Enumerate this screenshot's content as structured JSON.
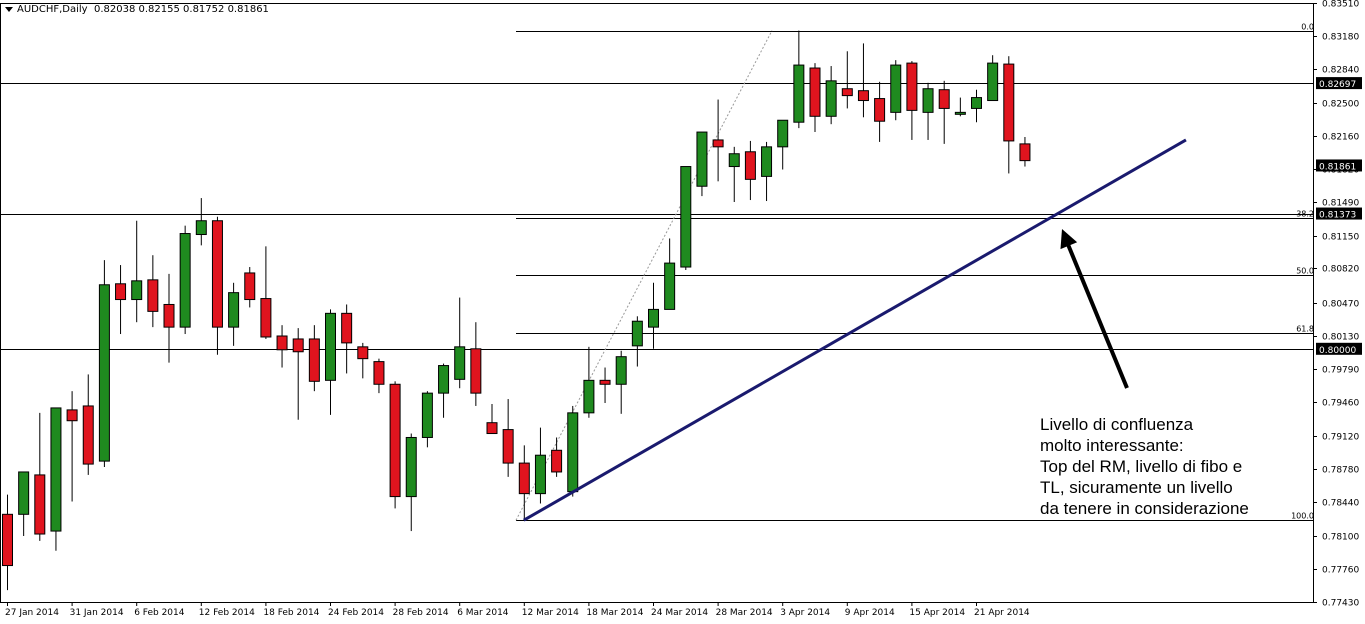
{
  "header": {
    "symbol": "AUDCHF,Daily",
    "ohlc": "0.82038 0.82155 0.81752 0.81861"
  },
  "annotation": {
    "lines": [
      "Livello di confluenza",
      "molto interessante:",
      "Top del RM, livello di fibo e",
      "TL, sicuramente un livello",
      "da tenere in considerazione"
    ]
  },
  "colors": {
    "bull": "#1f8a1f",
    "bear": "#e0141e",
    "trendline": "#1a1a6e",
    "text": "#000000"
  },
  "chart_data": {
    "type": "candlestick",
    "ylim": [
      0.7743,
      0.8351
    ],
    "y_ticks": [
      "0.83510",
      "0.83180",
      "0.82840",
      "0.82500",
      "0.82160",
      "0.81820",
      "0.81490",
      "0.81150",
      "0.80820",
      "0.80470",
      "0.80130",
      "0.79790",
      "0.79460",
      "0.79120",
      "0.78780",
      "0.78440",
      "0.78100",
      "0.77760",
      "0.77430"
    ],
    "x_ticks": [
      "27 Jan 2014",
      "31 Jan 2014",
      "6 Feb 2014",
      "12 Feb 2014",
      "18 Feb 2014",
      "24 Feb 2014",
      "28 Feb 2014",
      "6 Mar 2014",
      "12 Mar 2014",
      "18 Mar 2014",
      "24 Mar 2014",
      "28 Mar 2014",
      "3 Apr 2014",
      "9 Apr 2014",
      "15 Apr 2014",
      "21 Apr 2014"
    ],
    "price_labels": [
      {
        "text": "0.82697",
        "value": 0.82697
      },
      {
        "text": "0.81861",
        "value": 0.81861
      },
      {
        "text": "0.81373",
        "value": 0.81373
      },
      {
        "text": "0.80000",
        "value": 0.8
      }
    ],
    "horizontal_lines": [
      0.82697,
      0.81373,
      0.8
    ],
    "fibonacci": {
      "levels": [
        {
          "label": "0.0",
          "value": 0.8323
        },
        {
          "label": "38.2",
          "value": 0.8133
        },
        {
          "label": "50.0",
          "value": 0.8075
        },
        {
          "label": "61.8",
          "value": 0.8016
        },
        {
          "label": "100.0",
          "value": 0.7826
        }
      ]
    },
    "trendline": {
      "from": {
        "x": 32,
        "y": 0.7826
      },
      "to": {
        "x": 73,
        "y": 0.8212
      }
    },
    "candles": [
      {
        "i": 0,
        "o": 0.7832,
        "h": 0.7852,
        "l": 0.7755,
        "c": 0.778
      },
      {
        "i": 1,
        "o": 0.7832,
        "h": 0.7874,
        "l": 0.781,
        "c": 0.7875
      },
      {
        "i": 2,
        "o": 0.7872,
        "h": 0.7935,
        "l": 0.7805,
        "c": 0.7812
      },
      {
        "i": 3,
        "o": 0.7815,
        "h": 0.794,
        "l": 0.7795,
        "c": 0.794
      },
      {
        "i": 4,
        "o": 0.7938,
        "h": 0.7957,
        "l": 0.7845,
        "c": 0.7927
      },
      {
        "i": 5,
        "o": 0.7942,
        "h": 0.7974,
        "l": 0.7872,
        "c": 0.7883
      },
      {
        "i": 6,
        "o": 0.7886,
        "h": 0.809,
        "l": 0.788,
        "c": 0.8065
      },
      {
        "i": 7,
        "o": 0.8066,
        "h": 0.8085,
        "l": 0.8015,
        "c": 0.805
      },
      {
        "i": 8,
        "o": 0.805,
        "h": 0.813,
        "l": 0.8027,
        "c": 0.8069
      },
      {
        "i": 9,
        "o": 0.807,
        "h": 0.8095,
        "l": 0.8022,
        "c": 0.8038
      },
      {
        "i": 10,
        "o": 0.8045,
        "h": 0.8076,
        "l": 0.7986,
        "c": 0.8022
      },
      {
        "i": 11,
        "o": 0.8022,
        "h": 0.8125,
        "l": 0.8015,
        "c": 0.8117
      },
      {
        "i": 12,
        "o": 0.8116,
        "h": 0.8153,
        "l": 0.8105,
        "c": 0.813
      },
      {
        "i": 13,
        "o": 0.813,
        "h": 0.8134,
        "l": 0.7994,
        "c": 0.8022
      },
      {
        "i": 14,
        "o": 0.8022,
        "h": 0.8067,
        "l": 0.8003,
        "c": 0.8057
      },
      {
        "i": 15,
        "o": 0.8077,
        "h": 0.8083,
        "l": 0.8042,
        "c": 0.805
      },
      {
        "i": 16,
        "o": 0.8051,
        "h": 0.8104,
        "l": 0.801,
        "c": 0.8012
      },
      {
        "i": 17,
        "o": 0.8013,
        "h": 0.8024,
        "l": 0.7981,
        "c": 0.7999
      },
      {
        "i": 18,
        "o": 0.801,
        "h": 0.8021,
        "l": 0.7928,
        "c": 0.7997
      },
      {
        "i": 19,
        "o": 0.801,
        "h": 0.8024,
        "l": 0.7957,
        "c": 0.7967
      },
      {
        "i": 20,
        "o": 0.7968,
        "h": 0.804,
        "l": 0.7933,
        "c": 0.8036
      },
      {
        "i": 21,
        "o": 0.8036,
        "h": 0.8045,
        "l": 0.7975,
        "c": 0.8006
      },
      {
        "i": 22,
        "o": 0.8002,
        "h": 0.8006,
        "l": 0.797,
        "c": 0.799
      },
      {
        "i": 23,
        "o": 0.7987,
        "h": 0.799,
        "l": 0.7955,
        "c": 0.7964
      },
      {
        "i": 24,
        "o": 0.7964,
        "h": 0.7967,
        "l": 0.7838,
        "c": 0.785
      },
      {
        "i": 25,
        "o": 0.785,
        "h": 0.7914,
        "l": 0.7815,
        "c": 0.791
      },
      {
        "i": 26,
        "o": 0.791,
        "h": 0.7957,
        "l": 0.79,
        "c": 0.7955
      },
      {
        "i": 27,
        "o": 0.7955,
        "h": 0.7985,
        "l": 0.793,
        "c": 0.7983
      },
      {
        "i": 28,
        "o": 0.7969,
        "h": 0.8052,
        "l": 0.796,
        "c": 0.8002
      },
      {
        "i": 29,
        "o": 0.8,
        "h": 0.8027,
        "l": 0.7942,
        "c": 0.7955
      },
      {
        "i": 30,
        "o": 0.7925,
        "h": 0.7944,
        "l": 0.7916,
        "c": 0.7914
      },
      {
        "i": 31,
        "o": 0.7918,
        "h": 0.7949,
        "l": 0.787,
        "c": 0.7884
      },
      {
        "i": 32,
        "o": 0.7884,
        "h": 0.7902,
        "l": 0.7826,
        "c": 0.7853
      },
      {
        "i": 33,
        "o": 0.7853,
        "h": 0.792,
        "l": 0.7843,
        "c": 0.7892
      },
      {
        "i": 34,
        "o": 0.7897,
        "h": 0.791,
        "l": 0.787,
        "c": 0.7875
      },
      {
        "i": 35,
        "o": 0.7855,
        "h": 0.7942,
        "l": 0.785,
        "c": 0.7935
      },
      {
        "i": 36,
        "o": 0.7935,
        "h": 0.8002,
        "l": 0.793,
        "c": 0.7968
      },
      {
        "i": 37,
        "o": 0.7968,
        "h": 0.7981,
        "l": 0.7945,
        "c": 0.7964
      },
      {
        "i": 38,
        "o": 0.7964,
        "h": 0.7998,
        "l": 0.7934,
        "c": 0.7992
      },
      {
        "i": 39,
        "o": 0.8003,
        "h": 0.8033,
        "l": 0.7982,
        "c": 0.8028
      },
      {
        "i": 40,
        "o": 0.8022,
        "h": 0.8067,
        "l": 0.8,
        "c": 0.804
      },
      {
        "i": 41,
        "o": 0.804,
        "h": 0.8112,
        "l": 0.804,
        "c": 0.8087
      },
      {
        "i": 42,
        "o": 0.8083,
        "h": 0.8185,
        "l": 0.808,
        "c": 0.8185
      },
      {
        "i": 43,
        "o": 0.8165,
        "h": 0.822,
        "l": 0.8155,
        "c": 0.822
      },
      {
        "i": 44,
        "o": 0.8212,
        "h": 0.8253,
        "l": 0.817,
        "c": 0.8205
      },
      {
        "i": 45,
        "o": 0.8185,
        "h": 0.8205,
        "l": 0.8149,
        "c": 0.8198
      },
      {
        "i": 46,
        "o": 0.82,
        "h": 0.8211,
        "l": 0.8151,
        "c": 0.8172
      },
      {
        "i": 47,
        "o": 0.8175,
        "h": 0.821,
        "l": 0.815,
        "c": 0.8205
      },
      {
        "i": 48,
        "o": 0.8205,
        "h": 0.823,
        "l": 0.8182,
        "c": 0.8232
      },
      {
        "i": 49,
        "o": 0.823,
        "h": 0.8323,
        "l": 0.8224,
        "c": 0.8288
      },
      {
        "i": 50,
        "o": 0.8285,
        "h": 0.829,
        "l": 0.822,
        "c": 0.8236
      },
      {
        "i": 51,
        "o": 0.8236,
        "h": 0.8287,
        "l": 0.8228,
        "c": 0.8272
      },
      {
        "i": 52,
        "o": 0.8264,
        "h": 0.8302,
        "l": 0.8244,
        "c": 0.8257
      },
      {
        "i": 53,
        "o": 0.8262,
        "h": 0.831,
        "l": 0.8235,
        "c": 0.8252
      },
      {
        "i": 54,
        "o": 0.8254,
        "h": 0.8271,
        "l": 0.821,
        "c": 0.8231
      },
      {
        "i": 55,
        "o": 0.824,
        "h": 0.8293,
        "l": 0.8232,
        "c": 0.8288
      },
      {
        "i": 56,
        "o": 0.829,
        "h": 0.8292,
        "l": 0.8212,
        "c": 0.8242
      },
      {
        "i": 57,
        "o": 0.824,
        "h": 0.827,
        "l": 0.8212,
        "c": 0.8264
      },
      {
        "i": 58,
        "o": 0.8263,
        "h": 0.8272,
        "l": 0.8208,
        "c": 0.8244
      },
      {
        "i": 59,
        "o": 0.8238,
        "h": 0.8255,
        "l": 0.8236,
        "c": 0.824
      },
      {
        "i": 60,
        "o": 0.8244,
        "h": 0.8263,
        "l": 0.823,
        "c": 0.8255
      },
      {
        "i": 61,
        "o": 0.8252,
        "h": 0.8298,
        "l": 0.8252,
        "c": 0.829
      },
      {
        "i": 62,
        "o": 0.8289,
        "h": 0.8297,
        "l": 0.8178,
        "c": 0.8211
      },
      {
        "i": 63,
        "o": 0.8208,
        "h": 0.8215,
        "l": 0.8185,
        "c": 0.8191
      }
    ]
  }
}
